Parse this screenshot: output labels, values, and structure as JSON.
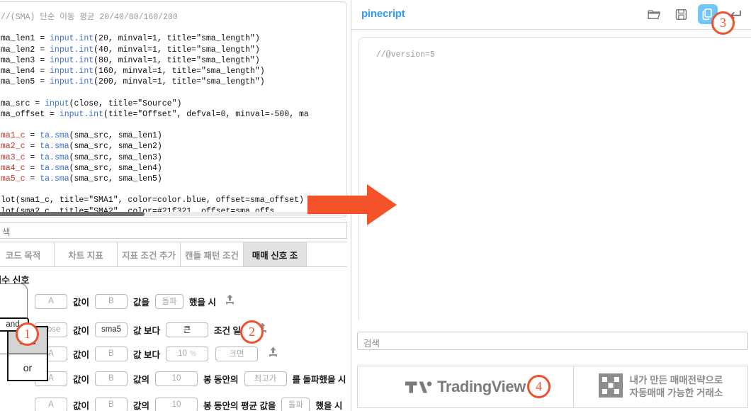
{
  "left_panel": {
    "code": {
      "comment_line": "//(SMA) 단순 이동 평균 20/40/80/160/200",
      "lines": [
        "ma_len1 = input.int(20, minval=1, title=\"sma_length\")",
        "ma_len2 = input.int(40, minval=1, title=\"sma_length\")",
        "ma_len3 = input.int(80, minval=1, title=\"sma_length\")",
        "ma_len4 = input.int(160, minval=1, title=\"sma_length\")",
        "ma_len5 = input.int(200, minval=1, title=\"sma_length\")",
        "ma_src = input(close, title=\"Source\")",
        "ma_offset = input.int(title=\"Offset\", defval=0, minval=-500, ma",
        "ma1_c = ta.sma(sma_src, sma_len1)",
        "ma2_c = ta.sma(sma_src, sma_len2)",
        "ma3_c = ta.sma(sma_src, sma_len3)",
        "ma4_c = ta.sma(sma_src, sma_len4)",
        "ma5_c = ta.sma(sma_src, sma_len5)",
        "lot(sma1_c, title=\"SMA1\", color=color.blue, offset=sma_offset)",
        "lot(sma2_c, title=\"SMA2\", color=#21f321, offset=sma_offs"
      ]
    },
    "search": {
      "value": "색"
    },
    "tabs": [
      {
        "label": "코드 목적",
        "active": false
      },
      {
        "label": "차트 지표",
        "active": false
      },
      {
        "label": "지표 조건 추가",
        "active": false
      },
      {
        "label": "캔들 패턴 조건",
        "active": false
      },
      {
        "label": "매매 신호 조",
        "active": true
      }
    ],
    "signal_section": {
      "title": "매수 신호",
      "connector": {
        "value": "and",
        "options": [
          "and",
          "or"
        ],
        "selected": "and"
      },
      "rows": [
        {
          "connector": "",
          "field_a": "A",
          "mid_label_1": "값이",
          "field_b": "B",
          "mid_label_2": "값을",
          "operator": "돌파",
          "tail_label": "했을 시"
        },
        {
          "connector": "and",
          "field_a": "close",
          "mid_label_1": "값이",
          "field_b": "sma5",
          "mid_label_2": "값 보다",
          "operator": "큰",
          "tail_label": "조건 일시"
        },
        {
          "connector": "",
          "field_a": "A",
          "mid_label_1": "값이",
          "field_b": "B",
          "mid_label_2": "값 보다",
          "amount": "10",
          "unit": "%",
          "operator": "크면",
          "tail_label": ""
        },
        {
          "connector": "",
          "field_a": "A",
          "mid_label_1": "값이",
          "field_b": "B",
          "mid_label_2": "값의",
          "amount": "10",
          "mid_label_3": "봉 동안의",
          "operator": "최고가",
          "tail_label": "를 돌파했을 시"
        },
        {
          "connector": "",
          "field_a": "A",
          "mid_label_1": "값이",
          "field_b": "B",
          "mid_label_2": "값의",
          "amount": "10",
          "mid_label_3": "봉 동안의 평균 값을",
          "operator": "돌파",
          "tail_label": "했을 시"
        }
      ]
    }
  },
  "right_panel": {
    "title": "pinecript",
    "header_icons": [
      {
        "name": "folder-open-icon",
        "active": false
      },
      {
        "name": "save-icon",
        "active": false
      },
      {
        "name": "copy-icon",
        "active": true
      },
      {
        "name": "enter-icon",
        "active": false
      }
    ],
    "editor": {
      "code": "//@version=5"
    },
    "search": {
      "placeholder": "검색",
      "value": "검색"
    },
    "footer": {
      "tradingview_label": "TradingView",
      "exchange_text_line1": "내가 만든 매매전략으로",
      "exchange_text_line2": "자동매매 가능한 거래소"
    }
  },
  "annotations": {
    "badges": [
      {
        "id": "1",
        "label": "1"
      },
      {
        "id": "2",
        "label": "2"
      },
      {
        "id": "3",
        "label": "3"
      },
      {
        "id": "4",
        "label": "4"
      }
    ],
    "arrow": {
      "name": "flow-arrow-right",
      "color": "#f4532a"
    }
  },
  "colors": {
    "accent_blue": "#2f9bf4",
    "highlight_blue": "#6ec6fa",
    "annotation_orange": "#f1502f",
    "arrow_orange": "#f4532a",
    "tab_active_bg": "#e2e2e2"
  }
}
